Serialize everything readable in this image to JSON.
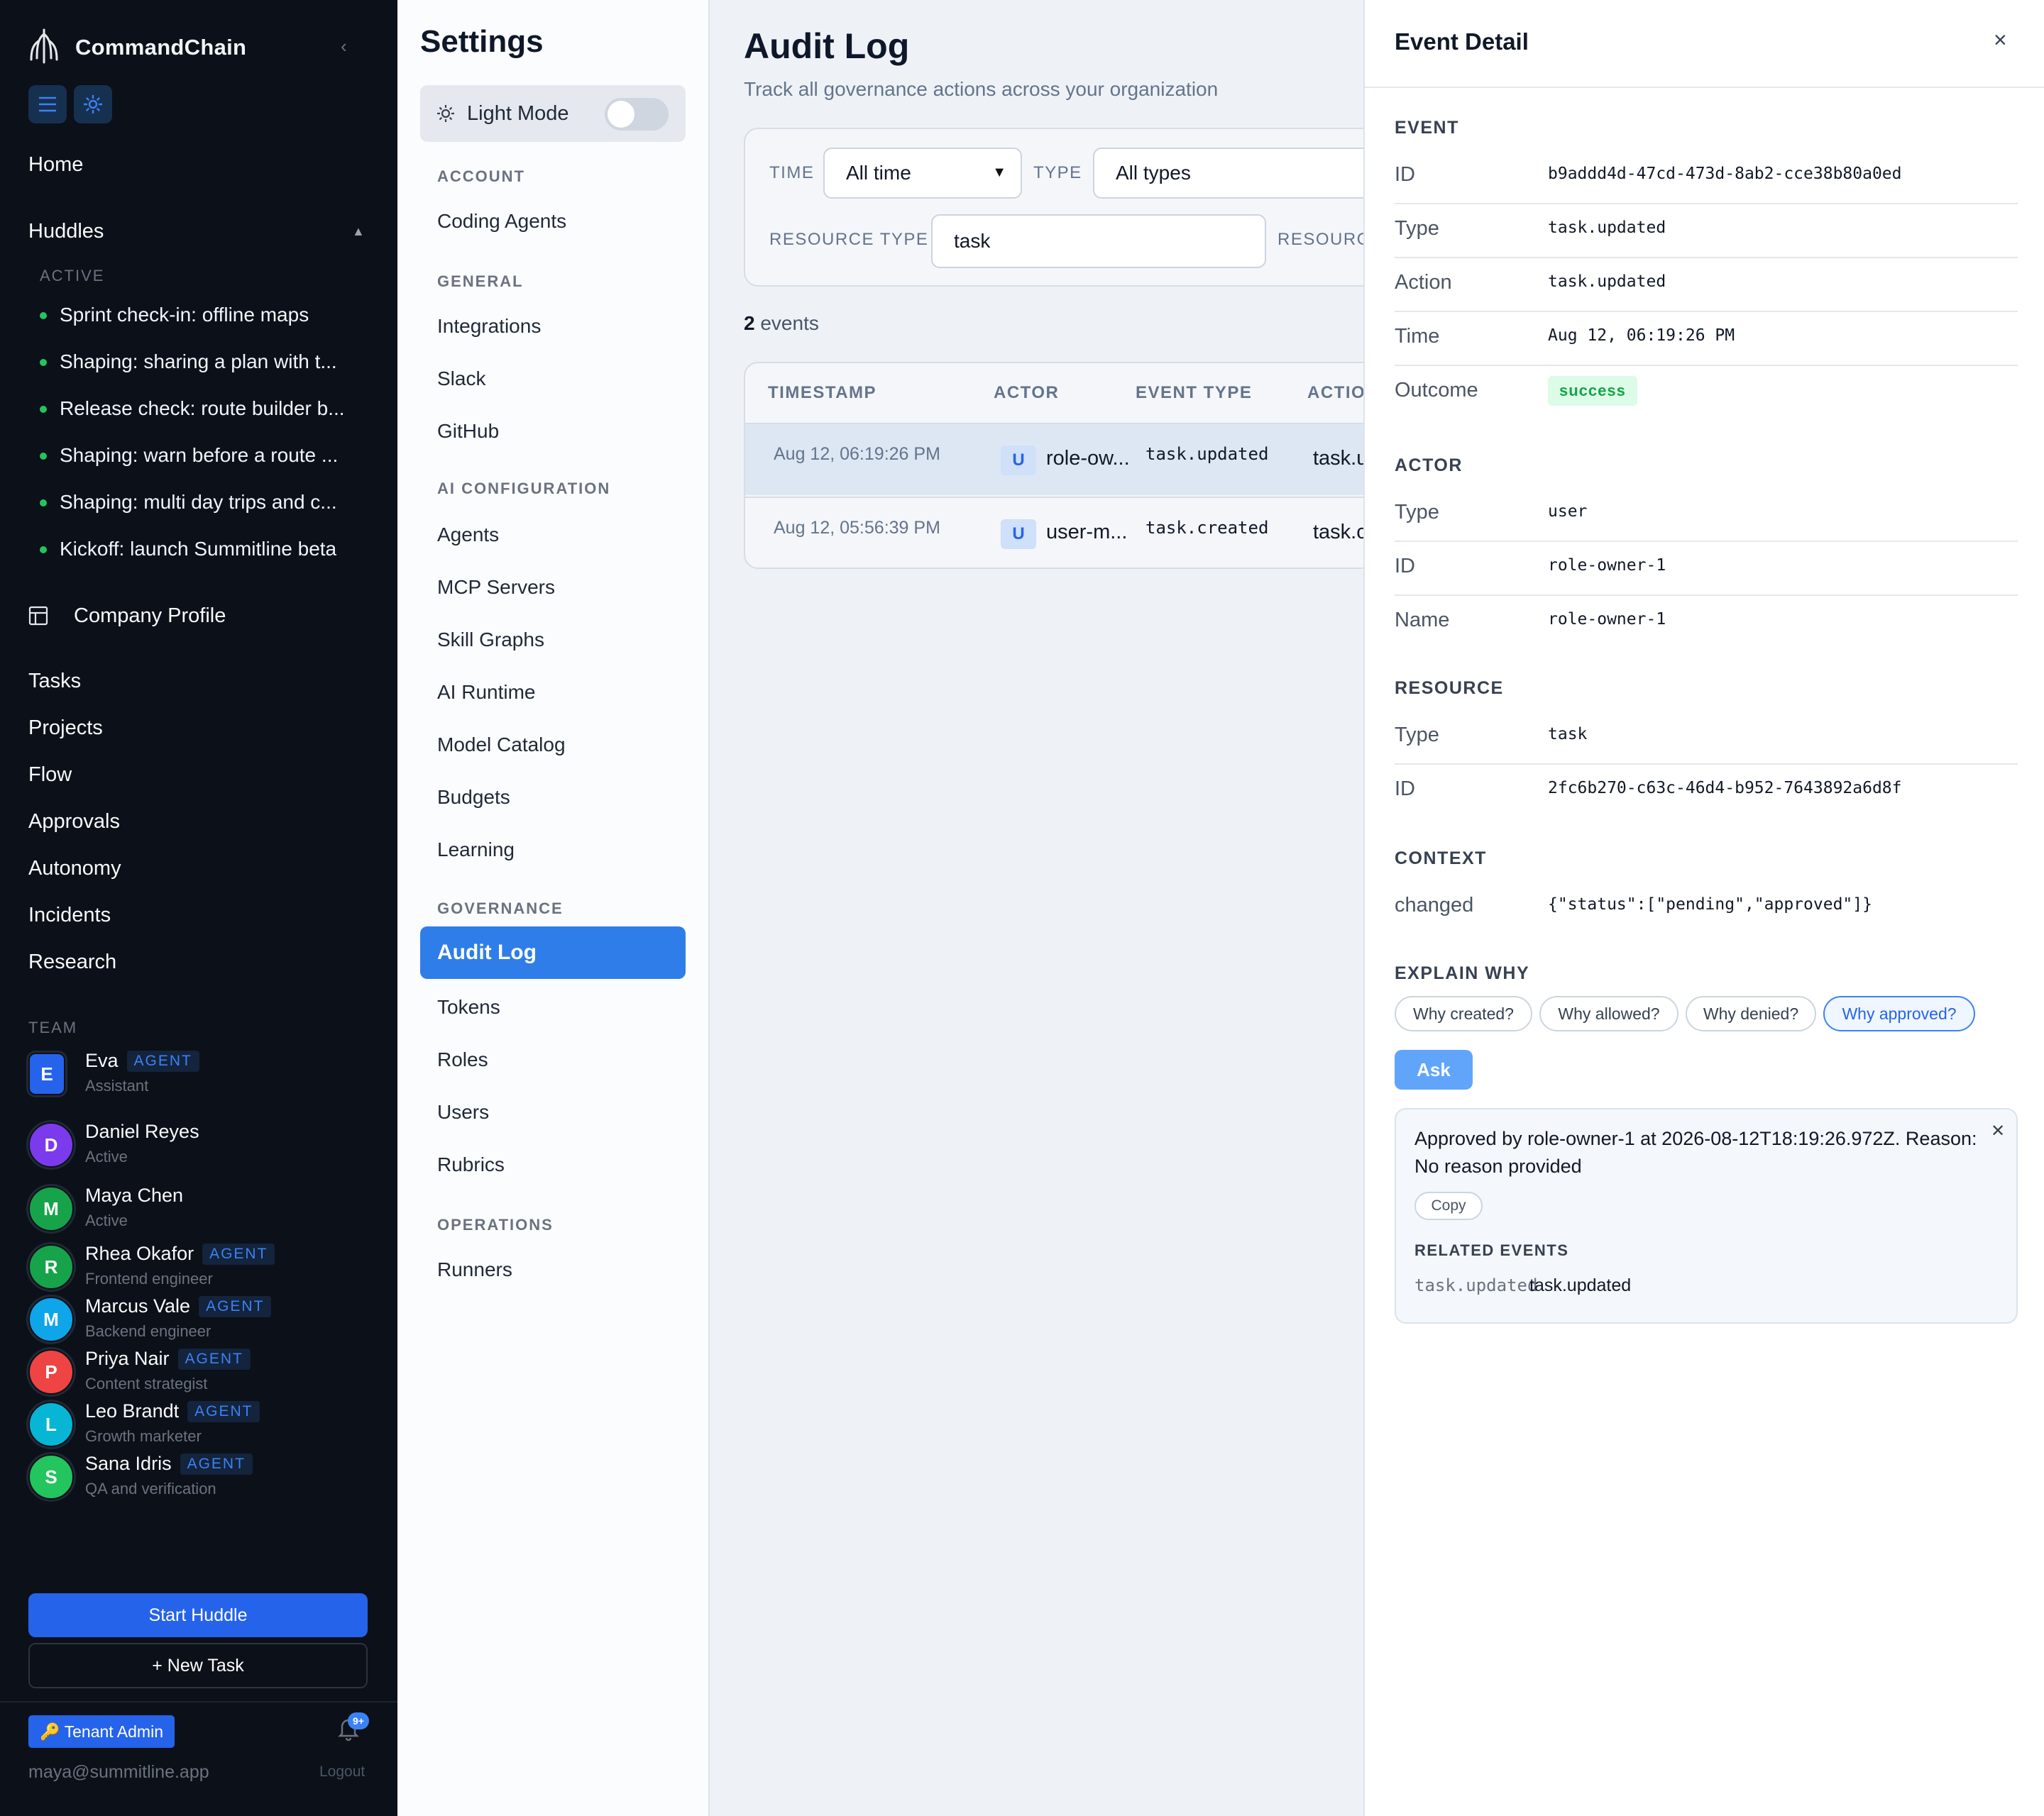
{
  "sidebar": {
    "brand": "CommandChain",
    "home": "Home",
    "huddles": "Huddles",
    "active_caps": "ACTIVE",
    "huddle_items": [
      "Sprint check-in: offline maps",
      "Shaping: sharing a plan with t...",
      "Release check: route builder b...",
      "Shaping: warn before a route ...",
      "Shaping: multi day trips and c...",
      "Kickoff: launch Summitline beta"
    ],
    "company_profile": "Company Profile",
    "nav": [
      "Tasks",
      "Projects",
      "Flow",
      "Approvals",
      "Autonomy",
      "Incidents",
      "Research"
    ],
    "team_caps": "TEAM",
    "agent_tag": "AGENT",
    "team": [
      {
        "initial": "E",
        "name": "Eva",
        "role": "Assistant",
        "agent": true,
        "color": "#2563eb"
      },
      {
        "initial": "D",
        "name": "Daniel Reyes",
        "role": "Active",
        "agent": false,
        "color": "#7c3aed"
      },
      {
        "initial": "M",
        "name": "Maya Chen",
        "role": "Active",
        "agent": false,
        "color": "#16a34a"
      },
      {
        "initial": "R",
        "name": "Rhea Okafor",
        "role": "Frontend engineer",
        "agent": true,
        "color": "#16a34a"
      },
      {
        "initial": "M",
        "name": "Marcus Vale",
        "role": "Backend engineer",
        "agent": true,
        "color": "#0ea5e9"
      },
      {
        "initial": "P",
        "name": "Priya Nair",
        "role": "Content strategist",
        "agent": true,
        "color": "#ef4444"
      },
      {
        "initial": "L",
        "name": "Leo Brandt",
        "role": "Growth marketer",
        "agent": true,
        "color": "#06b6d4"
      },
      {
        "initial": "S",
        "name": "Sana Idris",
        "role": "QA and verification",
        "agent": true,
        "color": "#22c55e"
      }
    ],
    "start_huddle": "Start Huddle",
    "new_task": "+ New Task",
    "tenant_admin": "🔑 Tenant Admin",
    "notif_badge": "9+",
    "email": "maya@summitline.app",
    "logout": "Logout"
  },
  "settings": {
    "title": "Settings",
    "light_mode": "Light Mode",
    "sections": [
      {
        "caps": "ACCOUNT",
        "items": [
          "Coding Agents"
        ]
      },
      {
        "caps": "GENERAL",
        "items": [
          "Integrations",
          "Slack",
          "GitHub"
        ]
      },
      {
        "caps": "AI CONFIGURATION",
        "items": [
          "Agents",
          "MCP Servers",
          "Skill Graphs",
          "AI Runtime",
          "Model Catalog",
          "Budgets",
          "Learning"
        ]
      },
      {
        "caps": "GOVERNANCE",
        "items": [
          "Audit Log",
          "Tokens",
          "Roles",
          "Users",
          "Rubrics"
        ]
      },
      {
        "caps": "OPERATIONS",
        "items": [
          "Runners"
        ]
      }
    ],
    "active_item": "Audit Log"
  },
  "main": {
    "title": "Audit Log",
    "subtitle": "Track all governance actions across your organization",
    "filters": {
      "time_label": "TIME",
      "time_value": "All time",
      "type_label": "TYPE",
      "type_value": "All types",
      "resource_type_label": "RESOURCE TYPE",
      "resource_type_value": "task",
      "resource_label": "RESOURC"
    },
    "count_num": "2",
    "count_label": " events",
    "table": {
      "headers": [
        "TIMESTAMP",
        "ACTOR",
        "EVENT TYPE",
        "ACTIO"
      ],
      "rows": [
        {
          "timestamp": "Aug 12, 06:19:26 PM",
          "badge": "U",
          "actor": "role-ow...",
          "event_type": "task.updated",
          "action": "task.u"
        },
        {
          "timestamp": "Aug 12, 05:56:39 PM",
          "badge": "U",
          "actor": "user-m...",
          "event_type": "task.created",
          "action": "task.c"
        }
      ]
    }
  },
  "detail": {
    "title": "Event Detail",
    "close": "×",
    "event_caps": "EVENT",
    "event": [
      {
        "key": "ID",
        "value": "b9addd4d-47cd-473d-8ab2-cce38b80a0ed"
      },
      {
        "key": "Type",
        "value": "task.updated"
      },
      {
        "key": "Action",
        "value": "task.updated"
      },
      {
        "key": "Time",
        "value": "Aug 12, 06:19:26 PM"
      }
    ],
    "outcome_key": "Outcome",
    "outcome_value": "success",
    "actor_caps": "ACTOR",
    "actor": [
      {
        "key": "Type",
        "value": "user"
      },
      {
        "key": "ID",
        "value": "role-owner-1"
      },
      {
        "key": "Name",
        "value": "role-owner-1"
      }
    ],
    "resource_caps": "RESOURCE",
    "resource": [
      {
        "key": "Type",
        "value": "task"
      },
      {
        "key": "ID",
        "value": "2fc6b270-c63c-46d4-b952-7643892a6d8f"
      }
    ],
    "context_caps": "CONTEXT",
    "context_key": "changed",
    "context_value": "{\"status\":[\"pending\",\"approved\"]}",
    "explain_caps": "EXPLAIN WHY",
    "chips": [
      "Why created?",
      "Why allowed?",
      "Why denied?",
      "Why approved?"
    ],
    "ask": "Ask",
    "answer": "Approved by role-owner-1 at 2026-08-12T18:19:26.972Z. Reason: No reason provided",
    "copy": "Copy",
    "related_caps": "RELATED EVENTS",
    "related_code": "task.updated",
    "related_text": "task.updated"
  },
  "colors": {
    "accent": "#2f7de8",
    "sidebar_bg": "#0c1018",
    "success": "#16a34a"
  }
}
